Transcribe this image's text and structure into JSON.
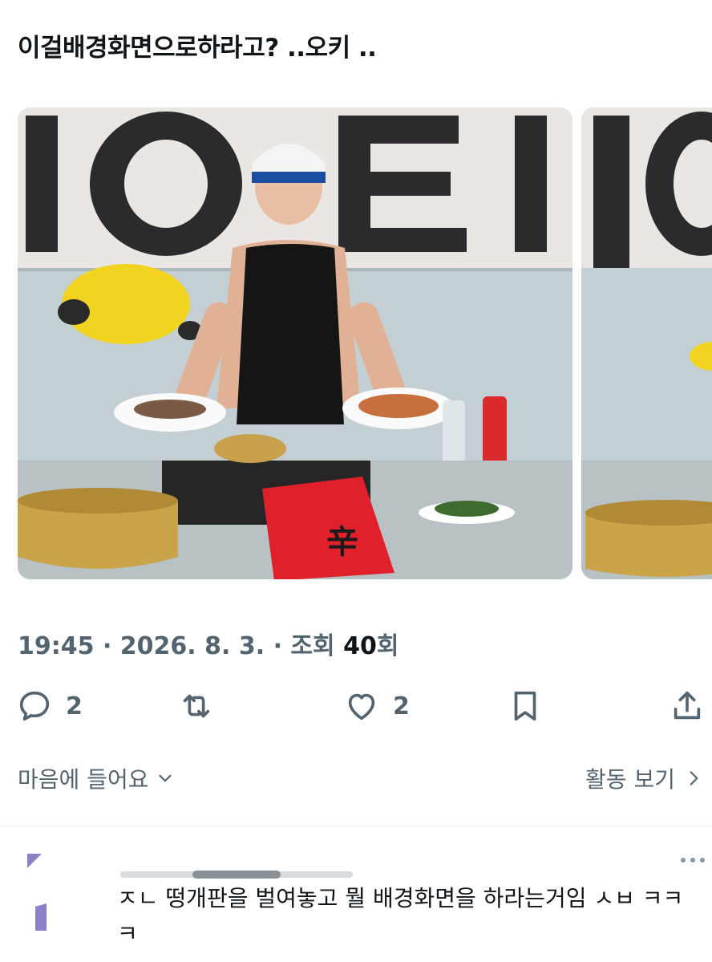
{
  "tweet": {
    "text": "이걸배경화면으로하라고? ..오키 .."
  },
  "media": {
    "photo_main_alt": "photo",
    "photo_next_alt": "photo",
    "ramen_pack_text": "辛"
  },
  "meta": {
    "time": "19:45",
    "sep1": " · ",
    "date": "2026. 8. 3.",
    "sep2": " · ",
    "views_label": "조회 ",
    "views_count": "40",
    "views_suffix": "회"
  },
  "actions": {
    "reply_count": "2",
    "like_count": "2"
  },
  "footer": {
    "likes_label": "마음에 들어요",
    "activity_label": "활동 보기"
  },
  "reply": {
    "text": "ㅈㄴ 떵개판을 벌여놓고 뭘 배경화면을 하라는거임 ㅅㅂ ㅋㅋㅋ"
  },
  "colors": {
    "text_primary": "#0f1419",
    "text_secondary": "#536471",
    "divider": "#eff3f4"
  }
}
